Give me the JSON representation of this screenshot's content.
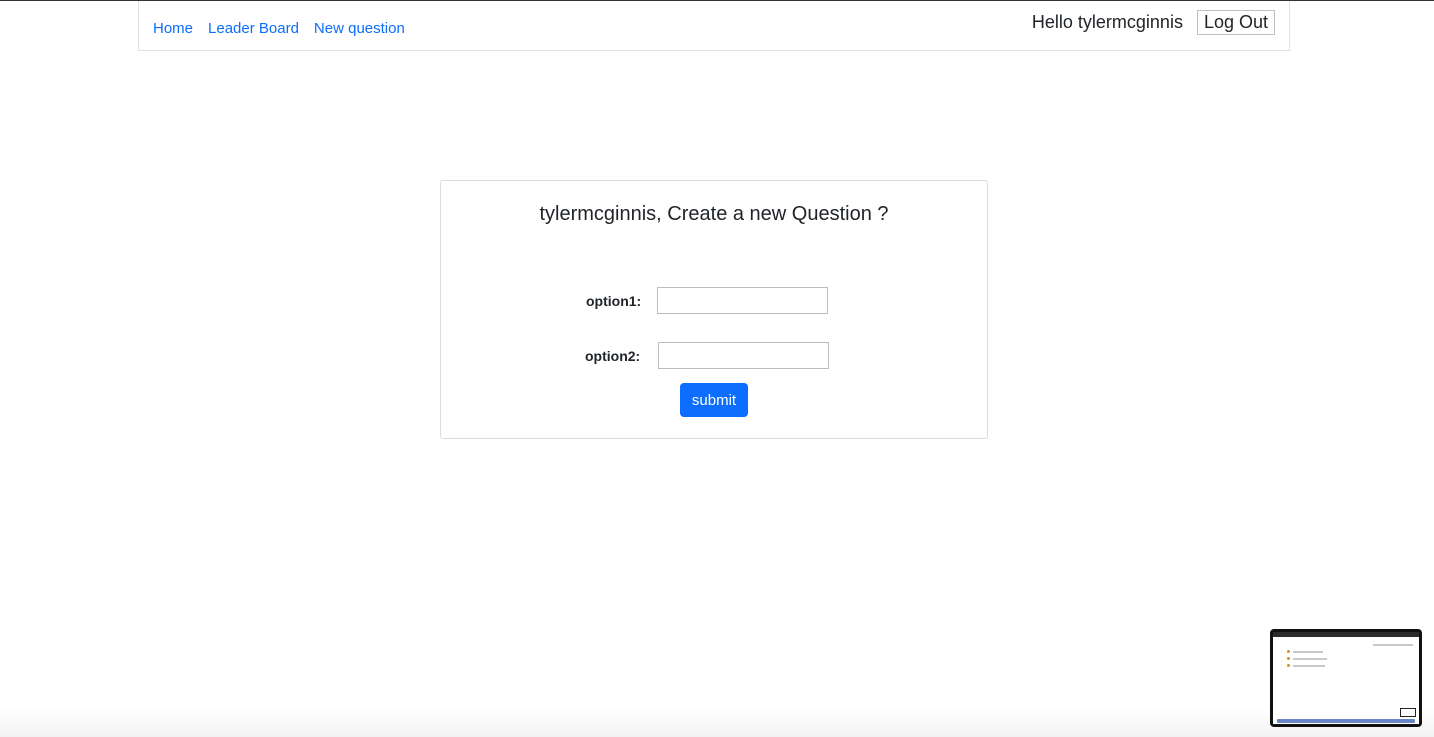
{
  "nav": {
    "links": [
      "Home",
      "Leader Board",
      "New question"
    ],
    "greeting": "Hello tylermcginnis",
    "logout_label": "Log Out"
  },
  "card": {
    "title": "tylermcginnis, Create a new Question ?",
    "option1_label": "option1:",
    "option1_value": "",
    "option2_label": "option2:",
    "option2_value": "",
    "submit_label": "submit"
  },
  "colors": {
    "link": "#0d6efd",
    "primary_button": "#0d6efd"
  }
}
